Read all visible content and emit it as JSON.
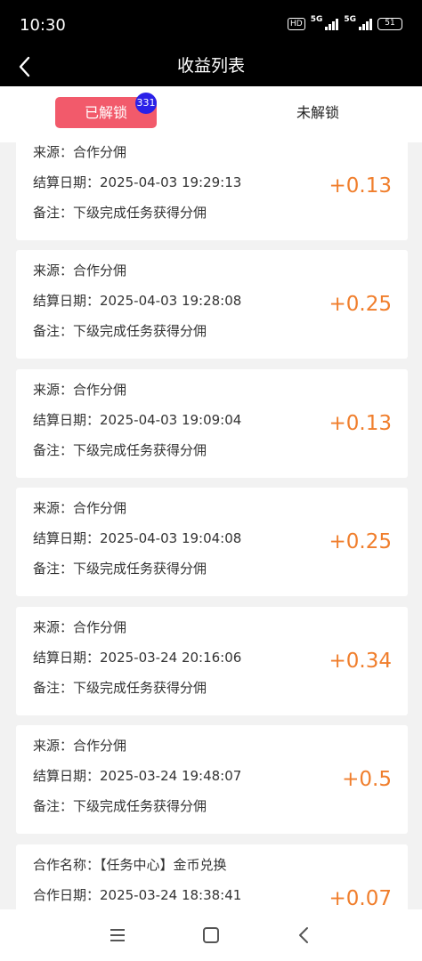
{
  "status_bar": {
    "time": "10:30",
    "hd_label": "HD",
    "network_1": "5G",
    "network_2": "5G",
    "battery": "51"
  },
  "header": {
    "title": "收益列表",
    "back_icon": "chevron-left-icon"
  },
  "tabs": {
    "unlocked_label": "已解锁",
    "unlocked_count": "331",
    "locked_label": "未解锁"
  },
  "colors": {
    "header_bg": "#000000",
    "active_tab": "#f25a6b",
    "badge": "#2a20e8",
    "amount": "#f07e2c"
  },
  "records": [
    {
      "source": "来源：合作分佣",
      "date": "结算日期：2025-04-03 19:29:13",
      "note": "备注：下级完成任务获得分佣",
      "amount": "+0.13"
    },
    {
      "source": "来源：合作分佣",
      "date": "结算日期：2025-04-03 19:28:08",
      "note": "备注：下级完成任务获得分佣",
      "amount": "+0.25"
    },
    {
      "source": "来源：合作分佣",
      "date": "结算日期：2025-04-03 19:09:04",
      "note": "备注：下级完成任务获得分佣",
      "amount": "+0.13"
    },
    {
      "source": "来源：合作分佣",
      "date": "结算日期：2025-04-03 19:04:08",
      "note": "备注：下级完成任务获得分佣",
      "amount": "+0.25"
    },
    {
      "source": "来源：合作分佣",
      "date": "结算日期：2025-03-24 20:16:06",
      "note": "备注：下级完成任务获得分佣",
      "amount": "+0.34"
    },
    {
      "source": "来源：合作分佣",
      "date": "结算日期：2025-03-24 19:48:07",
      "note": "备注：下级完成任务获得分佣",
      "amount": "+0.5"
    },
    {
      "source": "合作名称：【任务中心】金币兑换",
      "date": "合作日期：2025-03-24 18:38:41",
      "note": "",
      "amount": "+0.07"
    }
  ],
  "bottom_nav": {
    "menu_icon": "menu-icon",
    "home_icon": "home-square-icon",
    "back_icon": "back-arrow-icon"
  }
}
